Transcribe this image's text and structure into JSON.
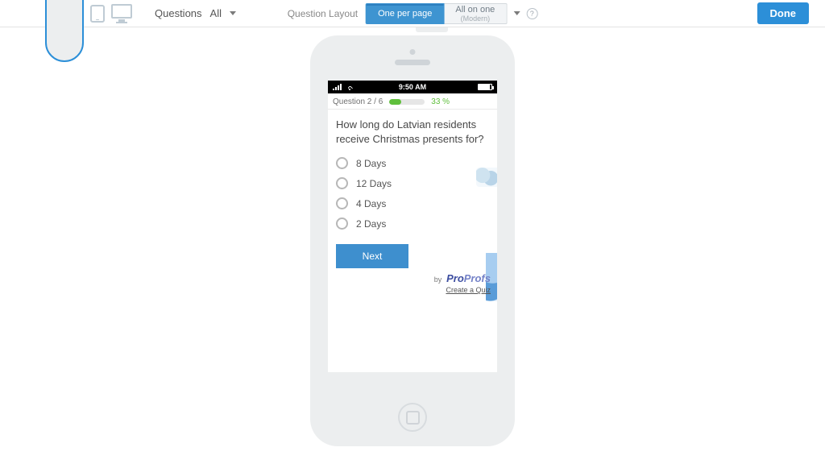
{
  "toolbar": {
    "questions_label": "Questions",
    "questions_filter_value": "All",
    "layout_label": "Question Layout",
    "layout_tabs": {
      "one_per_page": "One per page",
      "all_on_one": "All on one",
      "all_on_one_sub": "(Modern)"
    },
    "done_label": "Done"
  },
  "phone": {
    "status_time": "9:50 AM"
  },
  "quiz": {
    "counter": "Question 2 / 6",
    "progress_pct_text": "33 %",
    "progress_pct_value": 33,
    "question_text": "How long do Latvian residents receive Christmas presents for?",
    "options": [
      "8 Days",
      "12 Days",
      "4 Days",
      "2 Days"
    ],
    "next_label": "Next",
    "brand_by": "by",
    "brand_pro": "Pro",
    "brand_profs": "Profs",
    "create_link": "Create a Quiz"
  }
}
